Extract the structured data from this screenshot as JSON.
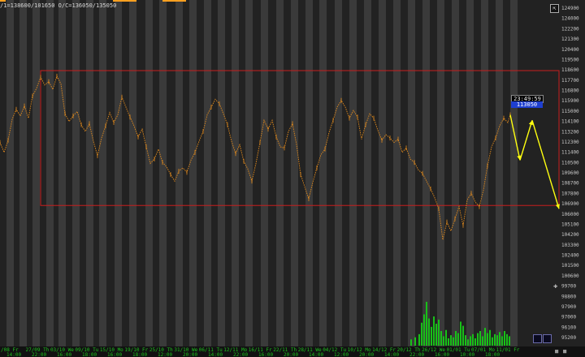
{
  "header": {
    "ohlc_text": "/1=138600/101650 O/C=136050/135050"
  },
  "badges": {
    "time": "23:49:59",
    "price": "113050"
  },
  "colors": {
    "background": "#222222",
    "band_light": "#3a3a3a",
    "price_series": "#e08a1e",
    "forecast": "#ffff10",
    "volume": "#18c018",
    "range_box": "#c81e1e",
    "price_badge_bg": "#1e3fd0",
    "date_axis_text": "#1ec01e",
    "price_axis_text": "#c8c8c8",
    "top_highlight": "#ffa020"
  },
  "icons": {
    "corner": "resize-corner-icon",
    "crosshair": "crosshair-icon",
    "nav_left": "scroll-left-icon",
    "nav_right": "scroll-right-icon",
    "nav_box": "nav-box-icon"
  },
  "chart_data": {
    "type": "line",
    "price_axis": [
      "124900",
      "124000",
      "122200",
      "121300",
      "120400",
      "119500",
      "118600",
      "117700",
      "116800",
      "115900",
      "115000",
      "114100",
      "113200",
      "112300",
      "111400",
      "110500",
      "109600",
      "108700",
      "107800",
      "106900",
      "106000",
      "105100",
      "104200",
      "103300",
      "102400",
      "101500",
      "100600",
      "99700",
      "98800",
      "97900",
      "97000",
      "96100",
      "95200"
    ],
    "ylim": [
      94900,
      124700
    ],
    "date_labels": [
      "/08 Fr",
      "27/09 Th",
      "03/10 We",
      "09/10 Tu",
      "15/10 Mo",
      "19/10 Fr",
      "25/10 Th",
      "31/10 We",
      "06/11 Tu",
      "12/11 Mo",
      "16/11 Fr",
      "22/11 Th",
      "28/11 We",
      "04/12 Tu",
      "10/12 Mo",
      "14/12 Fr",
      "20/12 Th",
      "26/12 We",
      "01/01 Tu",
      "07/01 Mo",
      "11/01 Fr"
    ],
    "time_labels": [
      "14:00",
      "22:00",
      "16:00",
      "18:00",
      "16:00",
      "18:00",
      "12:00",
      "20:00",
      "14:00",
      "22:00",
      "16:00",
      "20:00",
      "14:00",
      "12:00",
      "20:00",
      "14:00",
      "22:00",
      "16:00",
      "10:00",
      "18:00"
    ],
    "price_series": [
      [
        0,
        112400
      ],
      [
        5,
        111500
      ],
      [
        10,
        112600
      ],
      [
        15,
        114500
      ],
      [
        20,
        115400
      ],
      [
        25,
        114800
      ],
      [
        30,
        115700
      ],
      [
        35,
        114600
      ],
      [
        40,
        116600
      ],
      [
        45,
        117300
      ],
      [
        50,
        118300
      ],
      [
        55,
        117600
      ],
      [
        60,
        117900
      ],
      [
        65,
        117200
      ],
      [
        70,
        118400
      ],
      [
        75,
        117700
      ],
      [
        80,
        115000
      ],
      [
        85,
        114300
      ],
      [
        90,
        114800
      ],
      [
        95,
        115200
      ],
      [
        100,
        114000
      ],
      [
        105,
        113400
      ],
      [
        110,
        114100
      ],
      [
        115,
        112500
      ],
      [
        120,
        111200
      ],
      [
        125,
        112800
      ],
      [
        130,
        113900
      ],
      [
        135,
        115100
      ],
      [
        140,
        114200
      ],
      [
        145,
        114900
      ],
      [
        150,
        116500
      ],
      [
        155,
        115600
      ],
      [
        160,
        114700
      ],
      [
        165,
        113900
      ],
      [
        170,
        112900
      ],
      [
        175,
        113600
      ],
      [
        180,
        112000
      ],
      [
        185,
        110500
      ],
      [
        190,
        110900
      ],
      [
        195,
        111800
      ],
      [
        200,
        110600
      ],
      [
        205,
        110200
      ],
      [
        210,
        109500
      ],
      [
        215,
        108900
      ],
      [
        220,
        109800
      ],
      [
        225,
        110100
      ],
      [
        230,
        109700
      ],
      [
        235,
        110800
      ],
      [
        240,
        111500
      ],
      [
        245,
        112500
      ],
      [
        250,
        113400
      ],
      [
        255,
        114900
      ],
      [
        260,
        115600
      ],
      [
        265,
        116300
      ],
      [
        270,
        115900
      ],
      [
        275,
        115000
      ],
      [
        280,
        114000
      ],
      [
        285,
        112500
      ],
      [
        290,
        111400
      ],
      [
        295,
        112200
      ],
      [
        300,
        110700
      ],
      [
        305,
        110000
      ],
      [
        310,
        108900
      ],
      [
        315,
        110500
      ],
      [
        320,
        112400
      ],
      [
        325,
        114400
      ],
      [
        330,
        113600
      ],
      [
        335,
        114400
      ],
      [
        340,
        112900
      ],
      [
        345,
        112000
      ],
      [
        350,
        111900
      ],
      [
        355,
        113400
      ],
      [
        360,
        114100
      ],
      [
        365,
        112200
      ],
      [
        370,
        109500
      ],
      [
        375,
        108400
      ],
      [
        380,
        107300
      ],
      [
        385,
        108800
      ],
      [
        390,
        110100
      ],
      [
        395,
        111300
      ],
      [
        400,
        111800
      ],
      [
        405,
        113300
      ],
      [
        410,
        114400
      ],
      [
        415,
        115600
      ],
      [
        420,
        116200
      ],
      [
        425,
        115600
      ],
      [
        430,
        114600
      ],
      [
        435,
        115300
      ],
      [
        440,
        114700
      ],
      [
        445,
        112700
      ],
      [
        450,
        114000
      ],
      [
        455,
        115000
      ],
      [
        460,
        114600
      ],
      [
        465,
        113500
      ],
      [
        470,
        112600
      ],
      [
        475,
        113100
      ],
      [
        480,
        112800
      ],
      [
        485,
        112400
      ],
      [
        490,
        112700
      ],
      [
        495,
        111500
      ],
      [
        500,
        111900
      ],
      [
        505,
        110900
      ],
      [
        510,
        110600
      ],
      [
        515,
        109900
      ],
      [
        520,
        109600
      ],
      [
        525,
        108900
      ],
      [
        530,
        108200
      ],
      [
        535,
        107400
      ],
      [
        540,
        106400
      ],
      [
        545,
        103600
      ],
      [
        550,
        105200
      ],
      [
        555,
        104400
      ],
      [
        560,
        105500
      ],
      [
        565,
        106600
      ],
      [
        570,
        104900
      ],
      [
        575,
        107200
      ],
      [
        580,
        107800
      ],
      [
        585,
        107000
      ],
      [
        590,
        106600
      ],
      [
        595,
        108100
      ],
      [
        600,
        110300
      ],
      [
        605,
        112000
      ],
      [
        610,
        112800
      ],
      [
        615,
        113900
      ],
      [
        620,
        114600
      ],
      [
        625,
        114200
      ],
      [
        628,
        114900
      ]
    ],
    "forecast": [
      [
        628,
        114900
      ],
      [
        640,
        110800
      ],
      [
        655,
        114400
      ],
      [
        688,
        106400
      ]
    ],
    "volume": [
      [
        505,
        600
      ],
      [
        510,
        800
      ],
      [
        515,
        1100
      ],
      [
        518,
        2200
      ],
      [
        521,
        3000
      ],
      [
        524,
        4200
      ],
      [
        527,
        2600
      ],
      [
        530,
        1800
      ],
      [
        533,
        2800
      ],
      [
        536,
        2100
      ],
      [
        539,
        2500
      ],
      [
        542,
        1400
      ],
      [
        545,
        900
      ],
      [
        548,
        1500
      ],
      [
        551,
        700
      ],
      [
        554,
        1000
      ],
      [
        557,
        800
      ],
      [
        560,
        1400
      ],
      [
        563,
        1200
      ],
      [
        566,
        2300
      ],
      [
        569,
        1900
      ],
      [
        572,
        1000
      ],
      [
        575,
        600
      ],
      [
        578,
        900
      ],
      [
        581,
        1100
      ],
      [
        584,
        700
      ],
      [
        587,
        1200
      ],
      [
        590,
        1400
      ],
      [
        593,
        900
      ],
      [
        596,
        1700
      ],
      [
        599,
        1200
      ],
      [
        602,
        1500
      ],
      [
        605,
        800
      ],
      [
        608,
        1100
      ],
      [
        611,
        1000
      ],
      [
        614,
        1300
      ],
      [
        617,
        900
      ],
      [
        620,
        1400
      ],
      [
        623,
        1100
      ],
      [
        626,
        900
      ]
    ],
    "range_box": {
      "price_top": 118900,
      "price_bottom": 106700,
      "from_x": 50,
      "to_x": 688
    },
    "bands": [
      [
        8,
        17
      ],
      [
        24,
        33
      ],
      [
        40,
        49
      ],
      [
        57,
        66
      ],
      [
        72,
        81
      ],
      [
        89,
        98
      ],
      [
        106,
        115
      ],
      [
        122,
        131
      ],
      [
        141,
        150
      ],
      [
        159,
        168
      ],
      [
        179,
        188
      ],
      [
        196,
        205
      ],
      [
        216,
        225
      ],
      [
        233,
        242
      ],
      [
        251,
        260
      ],
      [
        268,
        277
      ],
      [
        285,
        294
      ],
      [
        302,
        311
      ],
      [
        321,
        330
      ],
      [
        340,
        349
      ],
      [
        358,
        367
      ],
      [
        376,
        385
      ],
      [
        393,
        402
      ],
      [
        412,
        421
      ],
      [
        430,
        439
      ],
      [
        448,
        457
      ],
      [
        466,
        475
      ],
      [
        484,
        493
      ],
      [
        502,
        511
      ],
      [
        520,
        529
      ],
      [
        538,
        547
      ],
      [
        556,
        565
      ],
      [
        574,
        583
      ],
      [
        592,
        601
      ],
      [
        610,
        619
      ],
      [
        628,
        637
      ]
    ],
    "top_highlights": [
      [
        0,
        7
      ],
      [
        139,
        168
      ],
      [
        200,
        229
      ]
    ]
  }
}
